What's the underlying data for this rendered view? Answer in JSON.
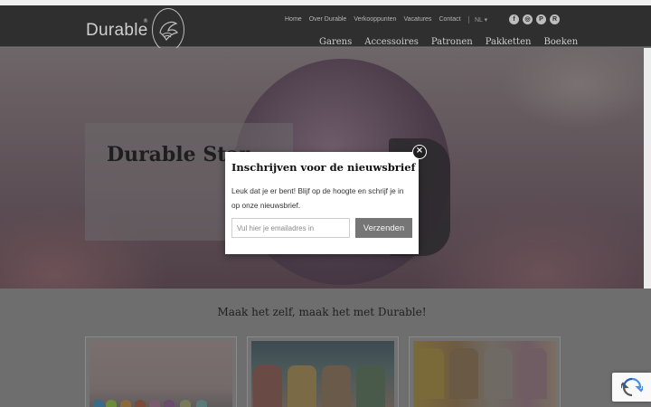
{
  "header": {
    "logo_text": "Durable",
    "logo_reg": "®",
    "top_links": [
      "Home",
      "Over Durable",
      "Verkooppunten",
      "Vacatures",
      "Contact"
    ],
    "language": "NL ▾",
    "social_icons": [
      {
        "icon": "facebook-icon",
        "glyph": "f"
      },
      {
        "icon": "instagram-icon",
        "glyph": "◎"
      },
      {
        "icon": "pinterest-icon",
        "glyph": "P"
      },
      {
        "icon": "ravelry-icon",
        "glyph": "R"
      }
    ],
    "main_nav": [
      "Garens",
      "Accessoires",
      "Patronen",
      "Pakketten",
      "Boeken"
    ]
  },
  "hero": {
    "title": "Durable Star"
  },
  "main": {
    "tagline": "Maak het zelf, maak het met Durable!"
  },
  "newsletter_modal": {
    "title": "Inschrijven voor de nieuwsbrief",
    "text": "Leuk dat je er bent! Blijf op de hoogte en schrijf je in op onze nieuwsbrief.",
    "email_placeholder": "Vul hier je emailadres in",
    "submit_label": "Verzenden",
    "close_glyph": "×"
  },
  "colors": {
    "header_bg": "#2f2f2f",
    "button_bg": "#767676",
    "overlay_dim": "#6e6e6e"
  }
}
